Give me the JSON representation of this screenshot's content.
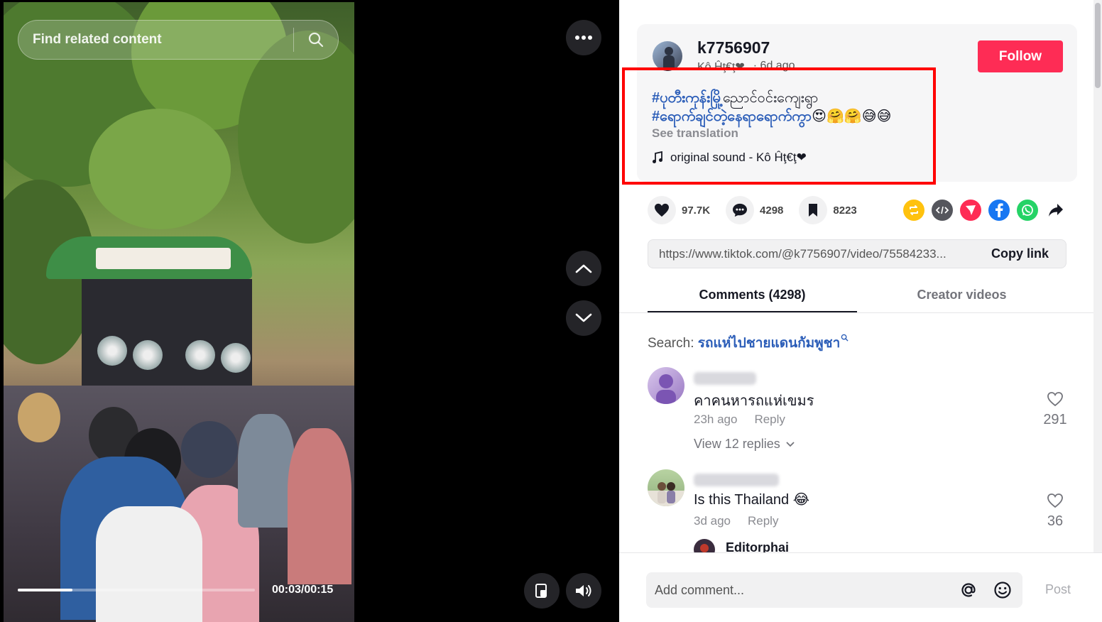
{
  "search": {
    "placeholder": "Find related content"
  },
  "player": {
    "time": "00:03/00:15",
    "progress": 0.23
  },
  "author": {
    "username": "k7756907",
    "nickname": "Kô Ĥţ€ţ❤",
    "posted": "6d ago",
    "follow_label": "Follow"
  },
  "caption": {
    "line1_tag": "#ပုတီးကုန်းမြို့",
    "line1_text": "ညောင်ဝင်းကျေးရွာ",
    "line2_tag": "#ရောက်ချင်တဲ့နေရာရောက်ကွာ",
    "line2_emoji": "😍🤗🤗😅😅",
    "see_translation": "See translation",
    "sound": "original sound - Kô Ĥţ€ţ❤"
  },
  "stats": {
    "likes": "97.7K",
    "comments": "4298",
    "saves": "8223"
  },
  "link": {
    "url": "https://www.tiktok.com/@k7756907/video/75584233...",
    "copy_label": "Copy link"
  },
  "tabs": [
    {
      "label": "Comments (4298)"
    },
    {
      "label": "Creator videos"
    }
  ],
  "related_search": {
    "prefix": "Search:",
    "query": "รถแห่ไปชายแดนกัมพูชา"
  },
  "comments": [
    {
      "text": "คาคนหารถแห่เขมร",
      "time": "23h ago",
      "reply": "Reply",
      "likes": "291",
      "view_replies": "View 12 replies"
    },
    {
      "text": "Is this Thailand 😂",
      "time": "3d ago",
      "reply": "Reply",
      "likes": "36"
    }
  ],
  "reply_preview": {
    "name": "Editorphai"
  },
  "composer": {
    "placeholder": "Add comment...",
    "post_label": "Post"
  },
  "colors": {
    "accent": "#fe2c55",
    "link": "#2b5db8",
    "highlight": "#ff0000"
  }
}
